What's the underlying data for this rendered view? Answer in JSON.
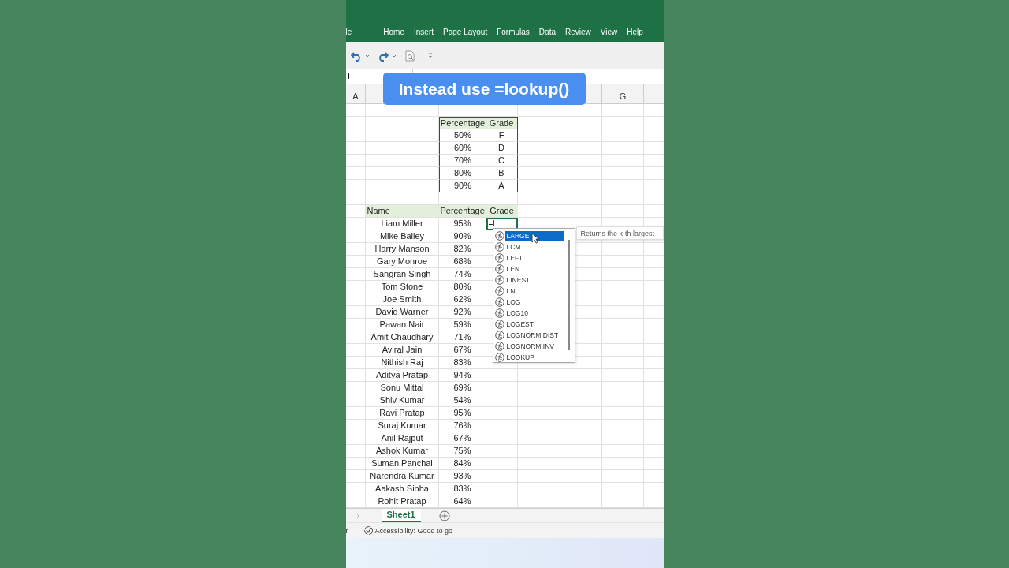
{
  "ribbon_tabs": [
    "le",
    "Home",
    "Insert",
    "Page Layout",
    "Formulas",
    "Data",
    "Review",
    "View",
    "Help"
  ],
  "name_box": {
    "value": "T"
  },
  "caption": "Instead use =lookup()",
  "column_headers": {
    "column_1": "A",
    "column_7": "G"
  },
  "lookup_table": {
    "columns": [
      "Percentage",
      "Grade"
    ],
    "rows": [
      [
        "50%",
        "F"
      ],
      [
        "60%",
        "D"
      ],
      [
        "70%",
        "C"
      ],
      [
        "80%",
        "B"
      ],
      [
        "90%",
        "A"
      ]
    ]
  },
  "student_table": {
    "columns": [
      "Name",
      "Percentage",
      "Grade"
    ],
    "rows": [
      {
        "name": "Liam Miller",
        "percentage": "95%"
      },
      {
        "name": "Mike Bailey",
        "percentage": "90%"
      },
      {
        "name": "Harry Manson",
        "percentage": "82%"
      },
      {
        "name": "Gary Monroe",
        "percentage": "68%"
      },
      {
        "name": "Sangran Singh",
        "percentage": "74%"
      },
      {
        "name": "Tom Stone",
        "percentage": "80%"
      },
      {
        "name": "Joe Smith",
        "percentage": "62%"
      },
      {
        "name": "David Warner",
        "percentage": "92%"
      },
      {
        "name": "Pawan Nair",
        "percentage": "59%"
      },
      {
        "name": "Amit Chaudhary",
        "percentage": "71%"
      },
      {
        "name": "Aviral Jain",
        "percentage": "67%"
      },
      {
        "name": "Nithish Raj",
        "percentage": "83%"
      },
      {
        "name": "Aditya Pratap",
        "percentage": "94%"
      },
      {
        "name": "Sonu Mittal",
        "percentage": "69%"
      },
      {
        "name": "Shiv Kumar",
        "percentage": "54%"
      },
      {
        "name": "Ravi Pratap",
        "percentage": "95%"
      },
      {
        "name": "Suraj Kumar",
        "percentage": "76%"
      },
      {
        "name": "Anil Rajput",
        "percentage": "67%"
      },
      {
        "name": "Ashok Kumar",
        "percentage": "75%"
      },
      {
        "name": "Suman Panchal",
        "percentage": "84%"
      },
      {
        "name": "Narendra Kumar",
        "percentage": "93%"
      },
      {
        "name": "Aakash Sinha",
        "percentage": "83%"
      },
      {
        "name": "Rohit Pratap",
        "percentage": "64%"
      }
    ]
  },
  "formula_input": "=l",
  "autocomplete": {
    "items": [
      {
        "label": "LARGE",
        "selected": true
      },
      {
        "label": "LCM",
        "selected": false
      },
      {
        "label": "LEFT",
        "selected": false
      },
      {
        "label": "LEN",
        "selected": false
      },
      {
        "label": "LINEST",
        "selected": false
      },
      {
        "label": "LN",
        "selected": false
      },
      {
        "label": "LOG",
        "selected": false
      },
      {
        "label": "LOG10",
        "selected": false
      },
      {
        "label": "LOGEST",
        "selected": false
      },
      {
        "label": "LOGNORM.DIST",
        "selected": false
      },
      {
        "label": "LOGNORM.INV",
        "selected": false
      },
      {
        "label": "LOOKUP",
        "selected": false
      }
    ]
  },
  "tooltip": "Returns the k-th largest",
  "sheet_tabs": [
    {
      "label": "Sheet1",
      "selected": true
    }
  ],
  "status_bar": {
    "left_text": "r",
    "accessibility": "Accessibility: Good to go"
  }
}
